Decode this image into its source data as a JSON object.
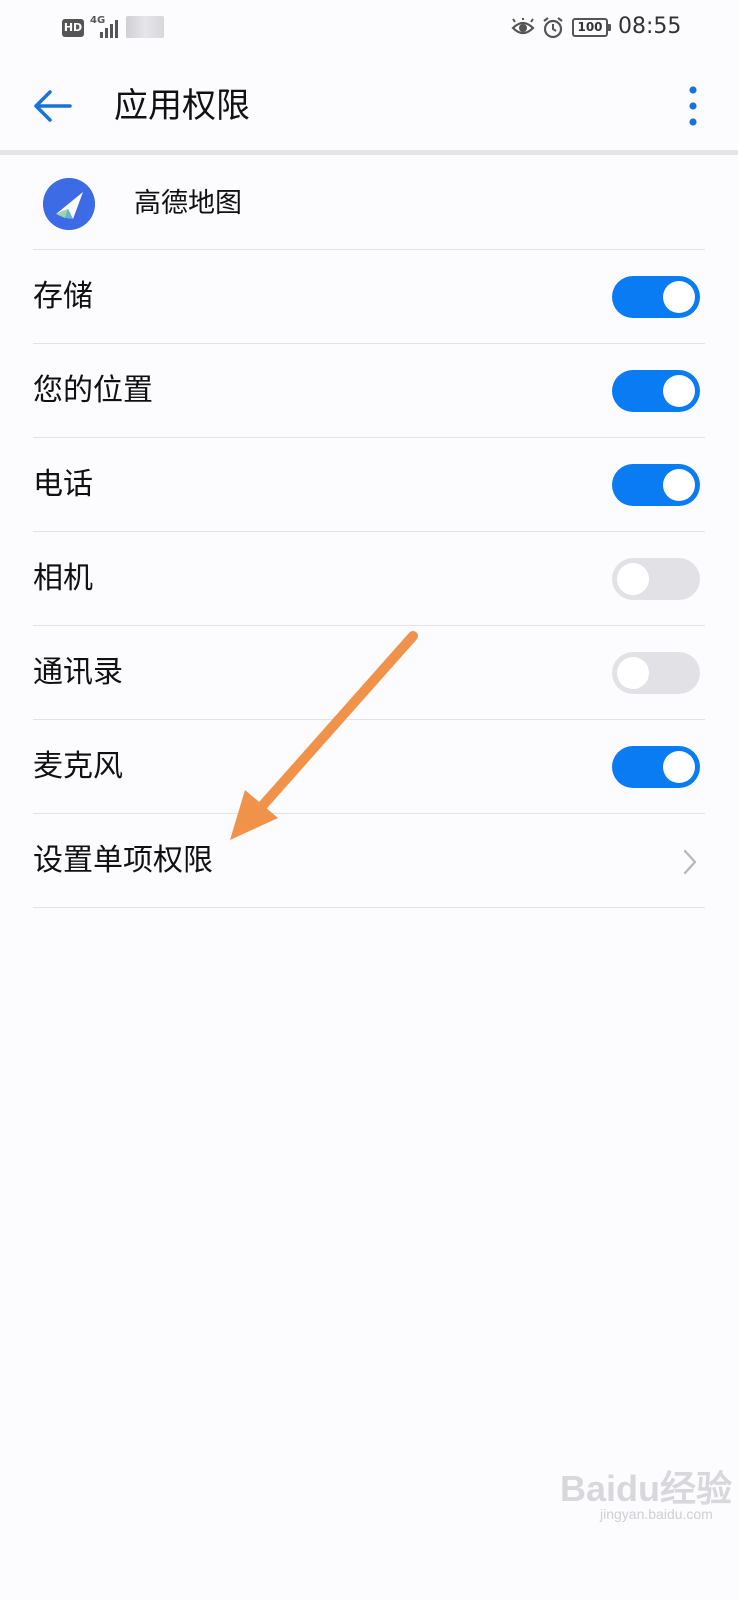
{
  "status_bar": {
    "hd": "HD",
    "network": "4G",
    "battery": "100",
    "time": "08:55"
  },
  "app_bar": {
    "title": "应用权限"
  },
  "app": {
    "name": "高德地图"
  },
  "permissions": [
    {
      "label": "存储",
      "enabled": true
    },
    {
      "label": "您的位置",
      "enabled": true
    },
    {
      "label": "电话",
      "enabled": true
    },
    {
      "label": "相机",
      "enabled": false
    },
    {
      "label": "通讯录",
      "enabled": false
    },
    {
      "label": "麦克风",
      "enabled": true
    }
  ],
  "individual_permissions": {
    "label": "设置单项权限"
  },
  "watermark": {
    "logo": "Baidu经验",
    "url": "jingyan.baidu.com"
  },
  "colors": {
    "accent": "#0a7cf3",
    "annotation_arrow": "#f0924a"
  }
}
